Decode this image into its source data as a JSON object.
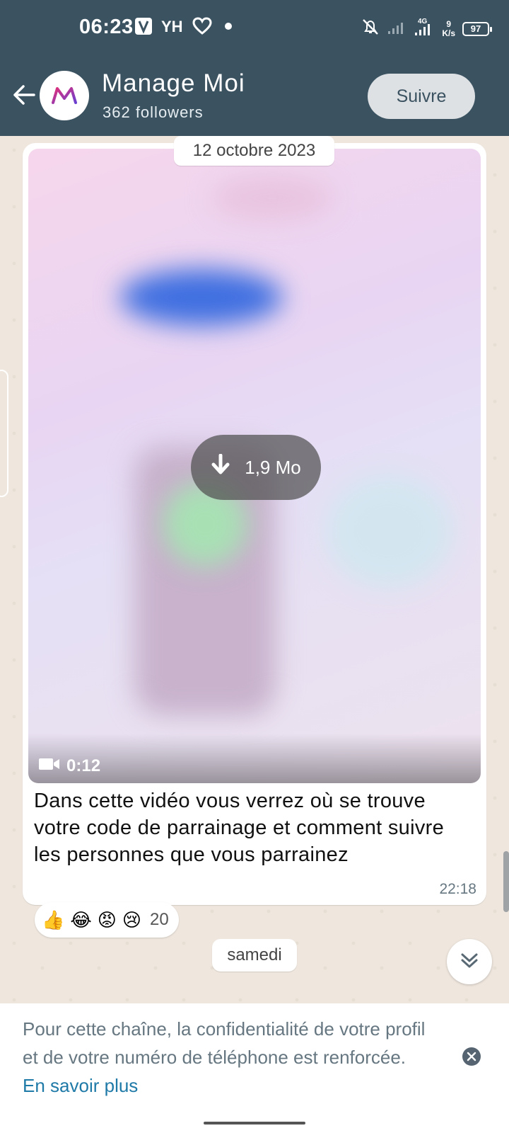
{
  "status_bar": {
    "time": "06:23",
    "left_icons": [
      "app-n-icon",
      "yh-icon",
      "heart-icon",
      "dot-icon"
    ],
    "network": "4G",
    "speed_value": "9",
    "speed_unit": "K/s",
    "battery": "97"
  },
  "channel": {
    "name": "Manage Moi",
    "followers": "362 followers",
    "follow_button": "Suivre"
  },
  "chat": {
    "date_chip": "12 octobre 2023",
    "message": {
      "download_size": "1,9 Mo",
      "duration": "0:12",
      "caption": "Dans cette vidéo vous verrez où se trouve votre code de parrainage et comment suivre les personnes que vous parrainez",
      "time": "22:18"
    },
    "reactions": {
      "emojis": [
        "👍",
        "😂",
        "😡",
        "😢"
      ],
      "count": "20"
    },
    "day_chip": "samedi"
  },
  "footer": {
    "text": "Pour cette chaîne, la confidentialité de votre profil et de votre numéro de téléphone est renforcée.",
    "link": "En savoir plus"
  }
}
